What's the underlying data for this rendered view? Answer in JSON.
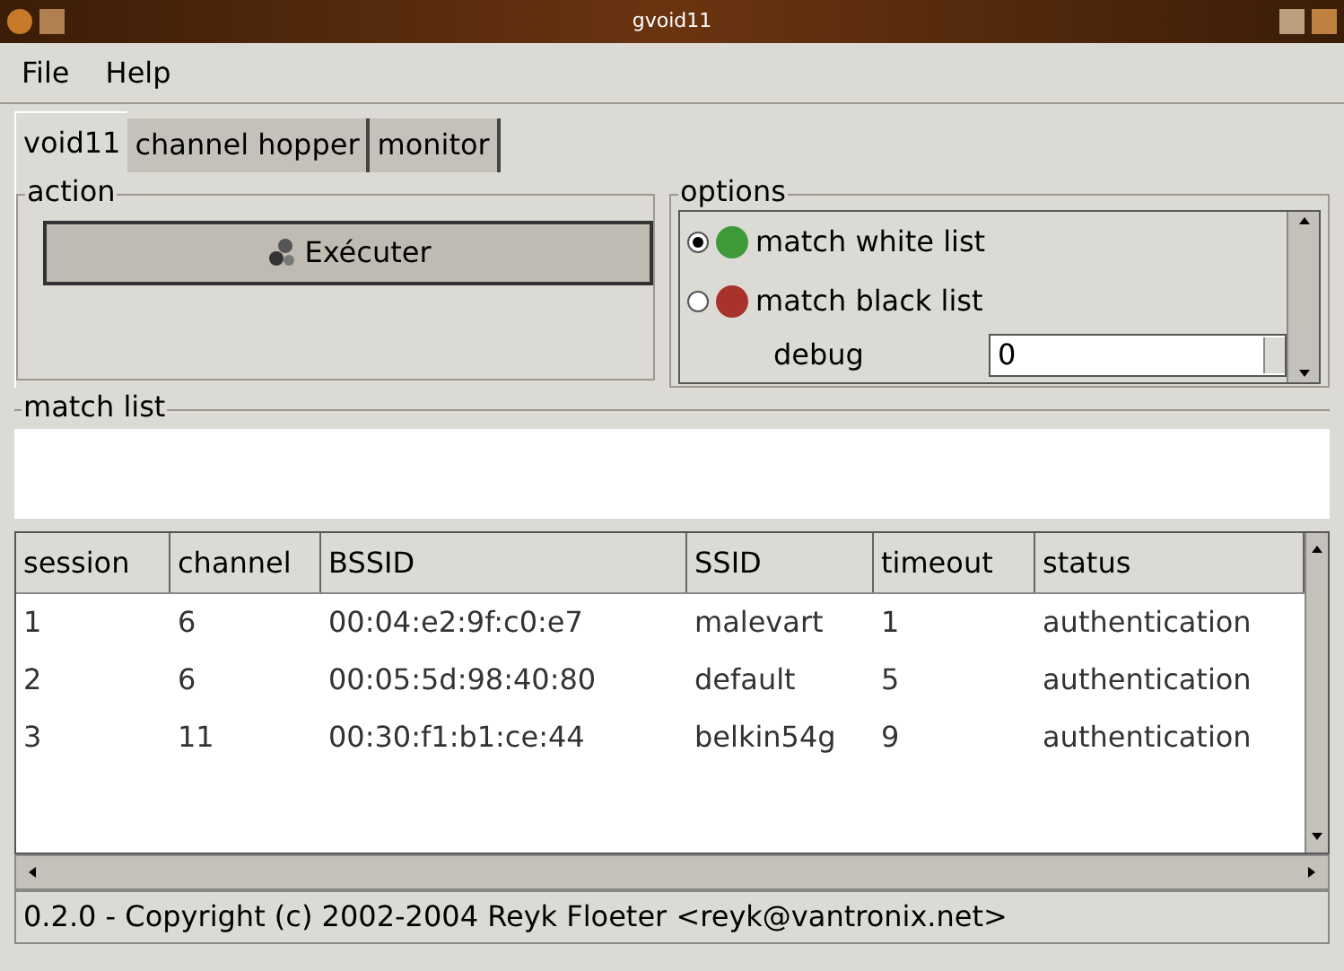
{
  "window": {
    "title": "gvoid11"
  },
  "menu": [
    {
      "label": "File"
    },
    {
      "label": "Help"
    }
  ],
  "tabs": [
    {
      "label": "void11",
      "selected": true
    },
    {
      "label": "channel hopper",
      "selected": false
    },
    {
      "label": "monitor",
      "selected": false
    }
  ],
  "action": {
    "title": "action",
    "button": "Exécuter"
  },
  "options": {
    "title": "options",
    "radios": [
      {
        "label": "match white list",
        "selected": true,
        "color": "#3f9a3a"
      },
      {
        "label": "match black list",
        "selected": false,
        "color": "#a8332c"
      }
    ],
    "debug": {
      "label": "debug",
      "value": "0"
    }
  },
  "match_list": {
    "title": "match list"
  },
  "table": {
    "columns": [
      "session",
      "channel",
      "BSSID",
      "SSID",
      "timeout",
      "status"
    ],
    "rows": [
      [
        "1",
        "6",
        "00:04:e2:9f:c0:e7",
        "malevart",
        "1",
        "authentication"
      ],
      [
        "2",
        "6",
        "00:05:5d:98:40:80",
        "default",
        "5",
        "authentication"
      ],
      [
        "3",
        "11",
        "00:30:f1:b1:ce:44",
        "belkin54g",
        "9",
        "authentication"
      ]
    ]
  },
  "status_bar": "0.2.0 - Copyright (c) 2002-2004 Reyk Floeter <reyk@vantronix.net>"
}
